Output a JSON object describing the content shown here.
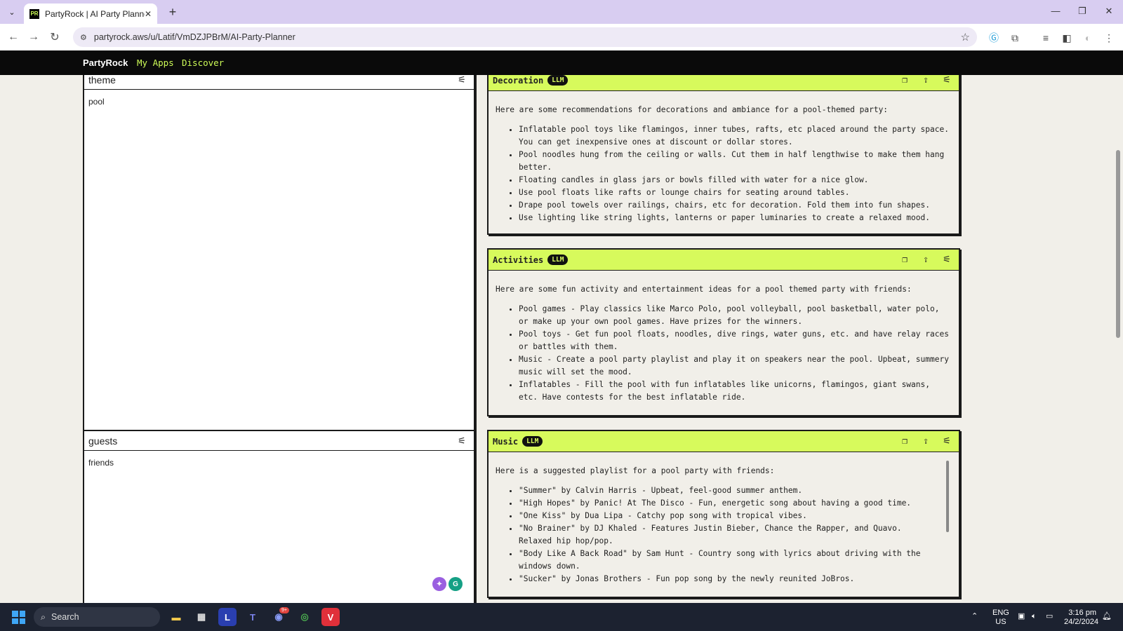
{
  "browser": {
    "tab_title": "PartyRock | AI Party Planner",
    "favicon_text": "PR",
    "url": "partyrock.aws/u/Latif/VmDZJPBrM/AI-Party-Planner"
  },
  "app_nav": {
    "brand": "PartyRock",
    "links": [
      "My Apps",
      "Discover"
    ]
  },
  "inputs": [
    {
      "title": "theme",
      "value": "pool"
    },
    {
      "title": "guests",
      "value": "friends"
    }
  ],
  "widgets": [
    {
      "title": "Decoration",
      "badge": "LLM",
      "intro": "Here are some recommendations for decorations and ambiance for a pool-themed party:",
      "items": [
        "Inflatable pool toys like flamingos, inner tubes, rafts, etc placed around the party space. You can get inexpensive ones at discount or dollar stores.",
        "Pool noodles hung from the ceiling or walls. Cut them in half lengthwise to make them hang better.",
        "Floating candles in glass jars or bowls filled with water for a nice glow.",
        "Use pool floats like rafts or lounge chairs for seating around tables.",
        "Drape pool towels over railings, chairs, etc for decoration. Fold them into fun shapes.",
        "Use lighting like string lights, lanterns or paper luminaries to create a relaxed mood."
      ]
    },
    {
      "title": "Activities",
      "badge": "LLM",
      "intro": "Here are some fun activity and entertainment ideas for a pool themed party with friends:",
      "items": [
        "Pool games - Play classics like Marco Polo, pool volleyball, pool basketball, water polo, or make up your own pool games. Have prizes for the winners.",
        "Pool toys - Get fun pool floats, noodles, dive rings, water guns, etc. and have relay races or battles with them.",
        "Music - Create a pool party playlist and play it on speakers near the pool. Upbeat, summery music will set the mood.",
        "Inflatables - Fill the pool with fun inflatables like unicorns, flamingos, giant swans, etc. Have contests for the best inflatable ride."
      ]
    },
    {
      "title": "Music",
      "badge": "LLM",
      "intro": "Here is a suggested playlist for a pool party with friends:",
      "items": [
        "\"Summer\" by Calvin Harris - Upbeat, feel-good summer anthem.",
        "\"High Hopes\" by Panic! At The Disco - Fun, energetic song about having a good time.",
        "\"One Kiss\" by Dua Lipa - Catchy pop song with tropical vibes.",
        "\"No Brainer\" by DJ Khaled - Features Justin Bieber, Chance the Rapper, and Quavo. Relaxed hip hop/pop.",
        "\"Body Like A Back Road\" by Sam Hunt - Country song with lyrics about driving with the windows down.",
        "\"Sucker\" by Jonas Brothers - Fun pop song by the newly reunited JoBros."
      ]
    }
  ],
  "taskbar": {
    "search_placeholder": "Search",
    "lang": "ENG",
    "region": "US",
    "time": "3:16 pm",
    "date": "24/2/2024",
    "discord_badge": "9+"
  }
}
